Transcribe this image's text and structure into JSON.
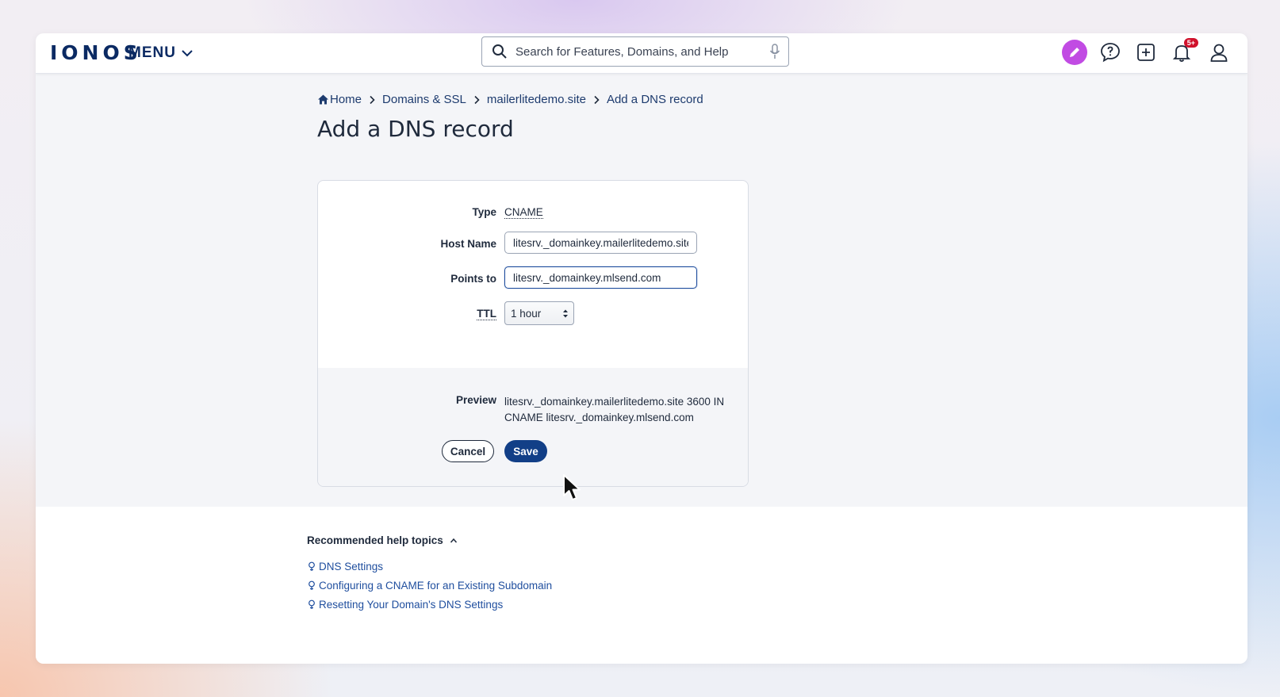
{
  "header": {
    "logo": "IONOS",
    "menu_label": "MENU",
    "search_placeholder": "Search for Features, Domains, and Help",
    "notification_badge": "5+"
  },
  "breadcrumb": {
    "items": [
      "Home",
      "Domains & SSL",
      "mailerlitedemo.site",
      "Add a DNS record"
    ]
  },
  "page_title": "Add a DNS record",
  "form": {
    "type_label": "Type",
    "type_value": "CNAME",
    "host_label": "Host Name",
    "host_value": "litesrv._domainkey.mailerlitedemo.site",
    "points_label": "Points to",
    "points_value": "litesrv._domainkey.mlsend.com",
    "ttl_label": "TTL",
    "ttl_value": "1 hour",
    "preview_label": "Preview",
    "preview_value": "litesrv._domainkey.mailerlitedemo.site  3600  IN CNAME  litesrv._domainkey.mlsend.com",
    "cancel_label": "Cancel",
    "save_label": "Save"
  },
  "help": {
    "title": "Recommended help topics",
    "links": [
      "DNS Settings",
      "Configuring a CNAME for an Existing Subdomain",
      "Resetting Your Domain's DNS Settings"
    ]
  },
  "colors": {
    "brand_navy": "#0b2a63",
    "save_button": "#123f87",
    "link": "#1f4e9e",
    "pen_button": "#c14be3",
    "badge": "#d0112b"
  }
}
